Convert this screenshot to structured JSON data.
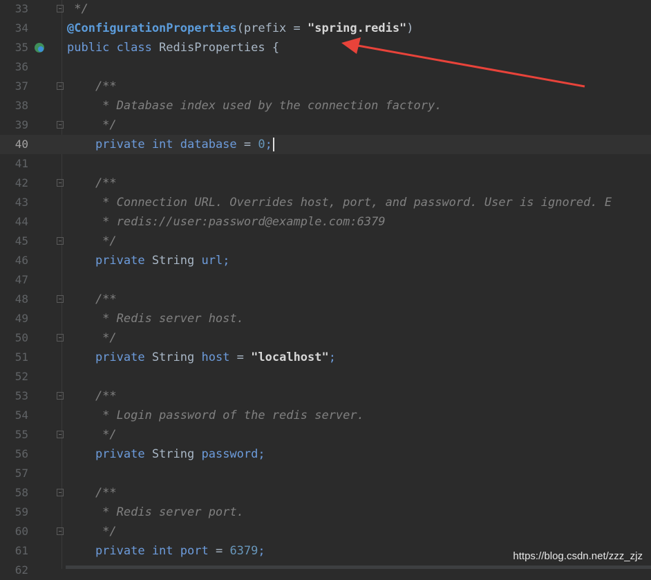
{
  "editor": {
    "lines": [
      {
        "num": "33",
        "fold": true,
        "tokens": [
          {
            "t": " */",
            "c": "c-cmt"
          }
        ]
      },
      {
        "num": "34",
        "tokens": [
          {
            "t": "@ConfigurationProperties",
            "c": "c-ann2"
          },
          {
            "t": "(prefix = ",
            "c": "c-plain"
          },
          {
            "t": "\"spring.redis\"",
            "c": "c-str2"
          },
          {
            "t": ")",
            "c": "c-plain"
          }
        ]
      },
      {
        "num": "35",
        "bean": true,
        "tokens": [
          {
            "t": "public class ",
            "c": "c-blue"
          },
          {
            "t": "RedisProperties {",
            "c": "c-plain"
          }
        ]
      },
      {
        "num": "36",
        "tokens": []
      },
      {
        "num": "37",
        "fold": true,
        "tokens": [
          {
            "t": "    /**",
            "c": "c-cmt"
          }
        ]
      },
      {
        "num": "38",
        "tokens": [
          {
            "t": "     * Database index used by the connection factory.",
            "c": "c-cmt"
          }
        ]
      },
      {
        "num": "39",
        "fold": true,
        "tokens": [
          {
            "t": "     */",
            "c": "c-cmt"
          }
        ]
      },
      {
        "num": "40",
        "current": true,
        "tokens": [
          {
            "t": "    private int ",
            "c": "c-blue"
          },
          {
            "t": "database",
            "c": "c-blue"
          },
          {
            "t": " = ",
            "c": "c-plain"
          },
          {
            "t": "0",
            "c": "c-num"
          },
          {
            "t": ";",
            "c": "c-blue"
          }
        ]
      },
      {
        "num": "41",
        "tokens": []
      },
      {
        "num": "42",
        "fold": true,
        "tokens": [
          {
            "t": "    /**",
            "c": "c-cmt"
          }
        ]
      },
      {
        "num": "43",
        "tokens": [
          {
            "t": "     * Connection URL. Overrides host, port, and password. User is ignored. E",
            "c": "c-cmt"
          }
        ]
      },
      {
        "num": "44",
        "tokens": [
          {
            "t": "     * redis://user:password@example.com:6379",
            "c": "c-cmt"
          }
        ]
      },
      {
        "num": "45",
        "fold": true,
        "tokens": [
          {
            "t": "     */",
            "c": "c-cmt"
          }
        ]
      },
      {
        "num": "46",
        "tokens": [
          {
            "t": "    private ",
            "c": "c-blue"
          },
          {
            "t": "String ",
            "c": "c-plain"
          },
          {
            "t": "url",
            "c": "c-blue"
          },
          {
            "t": ";",
            "c": "c-blue"
          }
        ]
      },
      {
        "num": "47",
        "tokens": []
      },
      {
        "num": "48",
        "fold": true,
        "tokens": [
          {
            "t": "    /**",
            "c": "c-cmt"
          }
        ]
      },
      {
        "num": "49",
        "tokens": [
          {
            "t": "     * Redis server host.",
            "c": "c-cmt"
          }
        ]
      },
      {
        "num": "50",
        "fold": true,
        "tokens": [
          {
            "t": "     */",
            "c": "c-cmt"
          }
        ]
      },
      {
        "num": "51",
        "tokens": [
          {
            "t": "    private ",
            "c": "c-blue"
          },
          {
            "t": "String ",
            "c": "c-plain"
          },
          {
            "t": "host",
            "c": "c-blue"
          },
          {
            "t": " = ",
            "c": "c-plain"
          },
          {
            "t": "\"localhost\"",
            "c": "c-str2"
          },
          {
            "t": ";",
            "c": "c-blue"
          }
        ]
      },
      {
        "num": "52",
        "tokens": []
      },
      {
        "num": "53",
        "fold": true,
        "tokens": [
          {
            "t": "    /**",
            "c": "c-cmt"
          }
        ]
      },
      {
        "num": "54",
        "tokens": [
          {
            "t": "     * Login password of the redis server.",
            "c": "c-cmt"
          }
        ]
      },
      {
        "num": "55",
        "fold": true,
        "tokens": [
          {
            "t": "     */",
            "c": "c-cmt"
          }
        ]
      },
      {
        "num": "56",
        "tokens": [
          {
            "t": "    private ",
            "c": "c-blue"
          },
          {
            "t": "String ",
            "c": "c-plain"
          },
          {
            "t": "password",
            "c": "c-blue"
          },
          {
            "t": ";",
            "c": "c-blue"
          }
        ]
      },
      {
        "num": "57",
        "tokens": []
      },
      {
        "num": "58",
        "fold": true,
        "tokens": [
          {
            "t": "    /**",
            "c": "c-cmt"
          }
        ]
      },
      {
        "num": "59",
        "tokens": [
          {
            "t": "     * Redis server port.",
            "c": "c-cmt"
          }
        ]
      },
      {
        "num": "60",
        "fold": true,
        "tokens": [
          {
            "t": "     */",
            "c": "c-cmt"
          }
        ]
      },
      {
        "num": "61",
        "tokens": [
          {
            "t": "    private int ",
            "c": "c-blue"
          },
          {
            "t": "port",
            "c": "c-blue"
          },
          {
            "t": " = ",
            "c": "c-plain"
          },
          {
            "t": "6379",
            "c": "c-num"
          },
          {
            "t": ";",
            "c": "c-blue"
          }
        ]
      },
      {
        "num": "62",
        "tokens": []
      }
    ]
  },
  "watermark": "https://blog.csdn.net/zzz_zjz",
  "colors": {
    "background": "#2b2b2b",
    "arrow": "#e8433a",
    "accent": "#6d9cdc"
  },
  "icons": {
    "bean": "spring-bean-icon",
    "fold": "fold-marker-icon",
    "arrow": "annotation-arrow-icon"
  }
}
